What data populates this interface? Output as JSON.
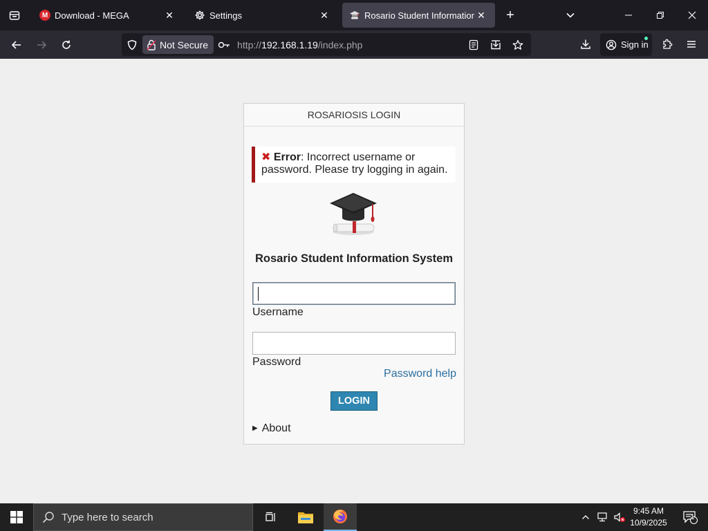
{
  "browser": {
    "tabs": [
      {
        "title": "Download - MEGA",
        "icon": "mega-icon",
        "active": false
      },
      {
        "title": "Settings",
        "icon": "gear-icon",
        "active": false
      },
      {
        "title": "Rosario Student Information Sys",
        "icon": "graduation-cap-icon",
        "active": true
      }
    ],
    "security_label": "Not Secure",
    "url_prefix": "http://",
    "url_host": "192.168.1.19",
    "url_path": "/index.php",
    "signin_label": "Sign in"
  },
  "page": {
    "box_title": "ROSARIOSIS LOGIN",
    "error_label": "Error",
    "error_message": ": Incorrect username or password. Please try logging in again.",
    "system_title": "Rosario Student Information System",
    "username_label": "Username",
    "username_value": "",
    "password_label": "Password",
    "password_value": "",
    "password_help": "Password help",
    "login_button": "LOGIN",
    "about_label": "About"
  },
  "taskbar": {
    "search_placeholder": "Type here to search",
    "time": "9:45 AM",
    "date": "10/9/2025",
    "notification_count": "1"
  },
  "colors": {
    "error_border": "#a1191a",
    "login_button": "#2e86b1",
    "link": "#2a6fa1"
  }
}
